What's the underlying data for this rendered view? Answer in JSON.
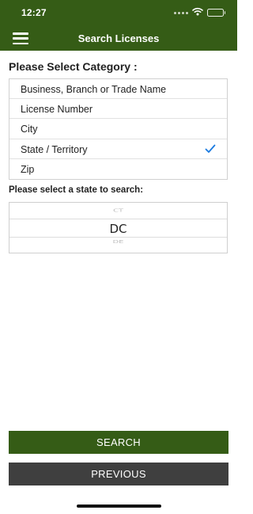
{
  "status_bar": {
    "time": "12:27",
    "icons": [
      "signal-dots-icon",
      "wifi-icon",
      "battery-icon"
    ]
  },
  "nav": {
    "title": "Search Licenses",
    "menu_icon": "hamburger-menu-icon"
  },
  "category": {
    "title": "Please Select Category :",
    "items": [
      {
        "label": "Business, Branch or Trade Name",
        "selected": false
      },
      {
        "label": "License Number",
        "selected": false
      },
      {
        "label": "City",
        "selected": false
      },
      {
        "label": "State / Territory",
        "selected": true
      },
      {
        "label": "Zip",
        "selected": false
      }
    ]
  },
  "state_picker": {
    "title": "Please select a state to search:",
    "previous": "CT",
    "current": "DC",
    "next": "DE"
  },
  "buttons": {
    "search": "SEARCH",
    "previous": "PREVIOUS"
  },
  "colors": {
    "brand_green": "#355c16",
    "dark_button": "#3f3f3f",
    "check_blue": "#1a7ae0"
  }
}
